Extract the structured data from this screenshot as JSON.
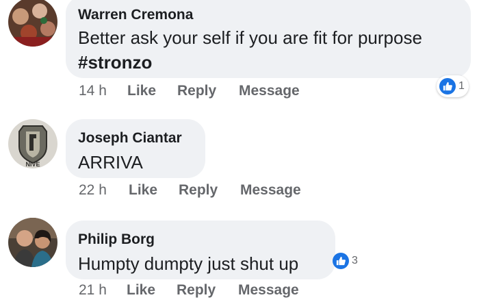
{
  "comments": [
    {
      "author": "Warren Cremona",
      "text": [
        "Better ask your self if you are fit for purpose",
        "#stronzo"
      ],
      "time": "14 h",
      "like_label": "Like",
      "reply_label": "Reply",
      "message_label": "Message",
      "reaction_count": "1"
    },
    {
      "author": "Joseph Ciantar",
      "text": [
        "ARRIVA"
      ],
      "time": "22 h",
      "like_label": "Like",
      "reply_label": "Reply",
      "message_label": "Message",
      "avatar_text": "NIVE"
    },
    {
      "author": "Philip Borg",
      "text": [
        "Humpty dumpty just shut up"
      ],
      "time": "21 h",
      "like_label": "Like",
      "reply_label": "Reply",
      "message_label": "Message",
      "reaction_count": "3"
    }
  ],
  "colors": {
    "bubble": "#eff1f4",
    "meta_text": "#65676b",
    "like_blue": "#1b74e4"
  }
}
